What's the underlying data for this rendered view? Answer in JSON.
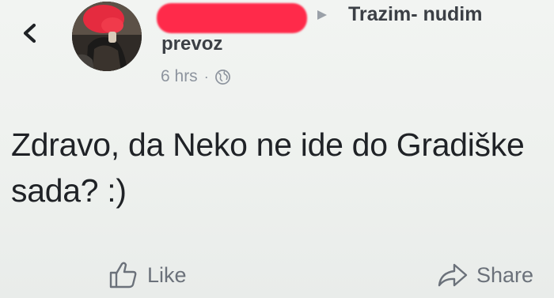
{
  "header": {
    "group_name_line1": "Trazim- nudim",
    "group_name_line2": "prevoz",
    "timestamp": "6 hrs",
    "separator": "·",
    "privacy_icon": "globe-icon"
  },
  "post": {
    "text": "Zdravo, da Neko ne ide do Gradiške sada? :)"
  },
  "actions": {
    "like_label": "Like",
    "share_label": "Share"
  },
  "colors": {
    "redaction": "#ff2a4a",
    "background": "#eef1ef",
    "text": "#1f2226",
    "muted": "#8d949e"
  }
}
